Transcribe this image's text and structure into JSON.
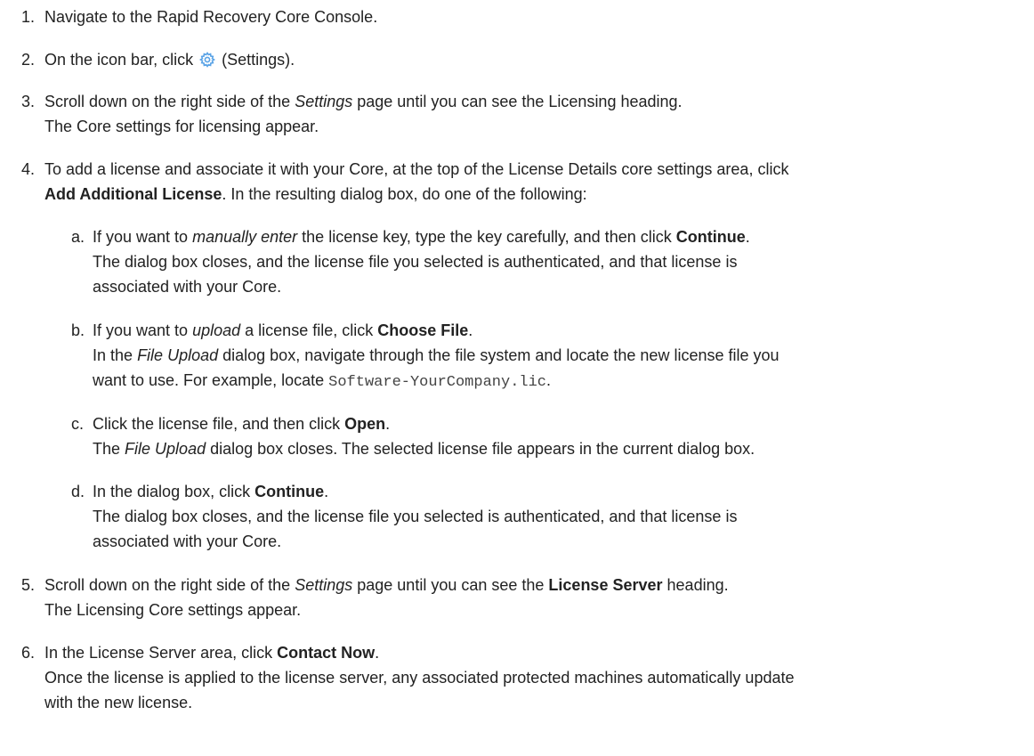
{
  "steps": [
    {
      "num": "1.",
      "text": "Navigate to the Rapid Recovery Core Console."
    },
    {
      "num": "2.",
      "pre": "On the icon bar, click",
      "icon": "gear-icon",
      "post": "(Settings)."
    },
    {
      "num": "3.",
      "l1a": "Scroll down on the right side of the",
      "l1em": "Settings",
      "l1b": "page until you can see the Licensing heading.",
      "l2": "The Core settings for licensing appear."
    },
    {
      "num": "4.",
      "l1": "To add a license and associate it with your Core, at the top of the License Details core settings area, click",
      "l2bold": "Add Additional License",
      "l2": ". In the resulting dialog box, do one of the following:"
    },
    {
      "num": "5.",
      "l1a": "Scroll down on the right side of the",
      "l1em": "Settings",
      "l1b": "page until you can see the",
      "l1bold": "License Server",
      "l1c": "heading.",
      "l2": "The Licensing Core settings appear."
    },
    {
      "num": "6.",
      "l1a": "In the License Server area, click",
      "l1bold": "Contact Now",
      "l1c": ".",
      "l2": "Once the license is applied to the license server, any associated protected machines automatically update",
      "l3": "with the new license."
    }
  ],
  "substeps": [
    {
      "num": "a.",
      "l1a": "If you want to",
      "l1em": "manually enter",
      "l1b": "the license key, type the key carefully, and then click",
      "l1bold": "Continue",
      "l1c": ".",
      "l2": "The dialog box closes, and the license file you selected is authenticated, and that license is",
      "l3": "associated with your Core."
    },
    {
      "num": "b.",
      "l1a": "If you want to",
      "l1em": "upload",
      "l1b": "a license file, click",
      "l1bold": "Choose File",
      "l1c": ".",
      "l2a": "In the",
      "l2em": "File Upload",
      "l2b": "dialog box, navigate through the file system and locate the new license file you",
      "l3a": "want to use. For example, locate",
      "l3code": "Software-YourCompany.lic",
      "l3b": "."
    },
    {
      "num": "c.",
      "l1a": "Click the license file, and then click",
      "l1bold": "Open",
      "l1c": ".",
      "l2a": "The",
      "l2em": "File Upload",
      "l2b": "dialog box closes. The selected license file appears in the current dialog box."
    },
    {
      "num": "d.",
      "l1a": "In the dialog box, click",
      "l1bold": "Continue",
      "l1c": ".",
      "l2": "The dialog box closes, and the license file you selected is authenticated, and that license is",
      "l3": "associated with your Core."
    }
  ],
  "colors": {
    "text": "#222222",
    "gear_icon": "#5aa3e6"
  }
}
